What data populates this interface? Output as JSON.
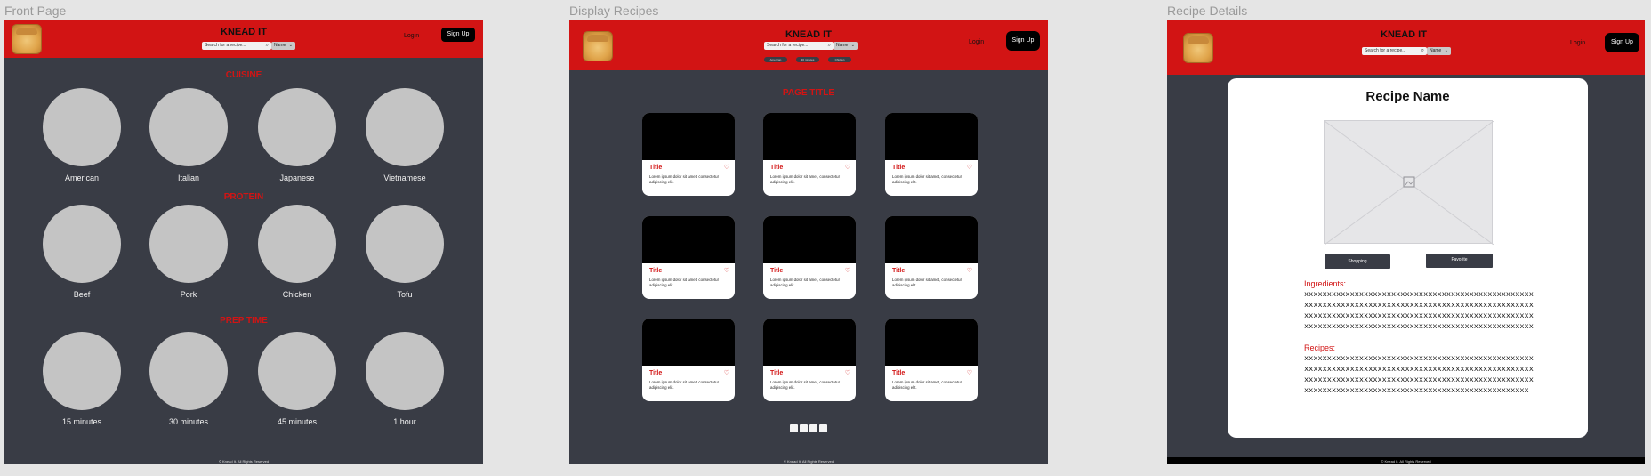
{
  "frames": {
    "front": {
      "label": "Front Page"
    },
    "display": {
      "label": "Display Recipes"
    },
    "details": {
      "label": "Recipe Details"
    }
  },
  "header": {
    "brand": "KNEAD IT",
    "search_placeholder": "Search for a recipe...",
    "filter_value": "Name",
    "login_label": "Login",
    "signup_label": "Sign Up"
  },
  "front_page": {
    "sections": [
      {
        "title": "CUISINE",
        "items": [
          "American",
          "Italian",
          "Japanese",
          "Vietnamese"
        ]
      },
      {
        "title": "PROTEIN",
        "items": [
          "Beef",
          "Pork",
          "Chicken",
          "Tofu"
        ]
      },
      {
        "title": "PREP TIME",
        "items": [
          "15 minutes",
          "30 minutes",
          "45 minutes",
          "1 hour"
        ]
      }
    ]
  },
  "display_recipes": {
    "filters": [
      "American",
      "30 minutes",
      "Chicken"
    ],
    "page_title": "PAGE TITLE",
    "card": {
      "title": "Title",
      "description": "Lorem ipsum dolor sit amet, consectetur adipiscing elit."
    },
    "pages": [
      "1",
      "2",
      "3",
      "4"
    ]
  },
  "recipe_details": {
    "title": "Recipe Name",
    "shopping_label": "Shopping",
    "favorite_label": "Favorite",
    "ingredients_label": "Ingredients:",
    "ingredients_text": "xxxxxxxxxxxxxxxxxxxxxxxxxxxxxxxxxxxxxxxxxxxxxxxxxx\nxxxxxxxxxxxxxxxxxxxxxxxxxxxxxxxxxxxxxxxxxxxxxxxxxx\nxxxxxxxxxxxxxxxxxxxxxxxxxxxxxxxxxxxxxxxxxxxxxxxxxx\nxxxxxxxxxxxxxxxxxxxxxxxxxxxxxxxxxxxxxxxxxxxxxxxxxx",
    "recipes_label": "Recipes:",
    "recipes_text": "xxxxxxxxxxxxxxxxxxxxxxxxxxxxxxxxxxxxxxxxxxxxxxxxxx\nxxxxxxxxxxxxxxxxxxxxxxxxxxxxxxxxxxxxxxxxxxxxxxxxxx\nxxxxxxxxxxxxxxxxxxxxxxxxxxxxxxxxxxxxxxxxxxxxxxxxxx\nxxxxxxxxxxxxxxxxxxxxxxxxxxxxxxxxxxxxxxxxxxxxxxxxx"
  },
  "footer": {
    "text": "© Knead It. All Rights Reserved"
  },
  "colors": {
    "brand_red": "#d21414",
    "background": "#393c45",
    "canvas": "#e5e5e5"
  },
  "icons": {
    "search": "magnifier-icon",
    "favorite": "heart-icon",
    "image": "image-placeholder-icon"
  }
}
